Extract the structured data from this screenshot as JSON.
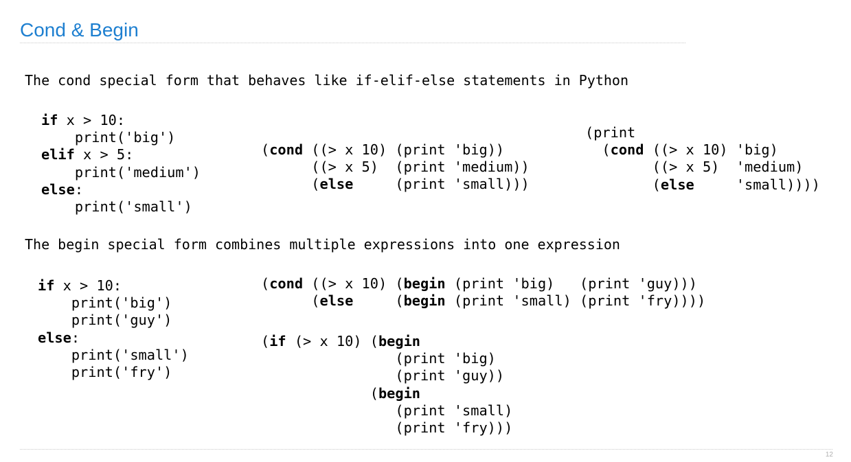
{
  "slide": {
    "title": "Cond & Begin",
    "page_number": "12"
  },
  "cond_section": {
    "description": "The cond special form that behaves like if-elif-else statements in Python",
    "python_lines": [
      [
        {
          "t": "if",
          "b": true
        },
        {
          "t": " x > 10:"
        }
      ],
      [
        {
          "t": "    print('big')"
        }
      ],
      [
        {
          "t": "elif",
          "b": true
        },
        {
          "t": " x > 5:"
        }
      ],
      [
        {
          "t": "    print('medium')"
        }
      ],
      [
        {
          "t": "else",
          "b": true
        },
        {
          "t": ":"
        }
      ],
      [
        {
          "t": "    print('small')"
        }
      ]
    ],
    "scheme_cond_lines": [
      [
        {
          "t": "("
        },
        {
          "t": "cond",
          "b": true
        },
        {
          "t": " ((> x 10) (print 'big))"
        }
      ],
      [
        {
          "t": "      ((> x 5)  (print 'medium))"
        }
      ],
      [
        {
          "t": "      ("
        },
        {
          "t": "else",
          "b": true
        },
        {
          "t": "     (print 'small)))"
        }
      ]
    ],
    "scheme_print_cond_lines": [
      [
        {
          "t": "(print"
        }
      ],
      [
        {
          "t": "  ("
        },
        {
          "t": "cond",
          "b": true
        },
        {
          "t": " ((> x 10) 'big)"
        }
      ],
      [
        {
          "t": "        ((> x 5)  'medium)"
        }
      ],
      [
        {
          "t": "        ("
        },
        {
          "t": "else",
          "b": true
        },
        {
          "t": "     'small))))"
        }
      ]
    ]
  },
  "begin_section": {
    "description": "The begin special form combines multiple expressions into one expression",
    "python_lines": [
      [
        {
          "t": "if",
          "b": true
        },
        {
          "t": " x > 10:"
        }
      ],
      [
        {
          "t": "    print('big')"
        }
      ],
      [
        {
          "t": "    print('guy')"
        }
      ],
      [
        {
          "t": "else",
          "b": true
        },
        {
          "t": ":"
        }
      ],
      [
        {
          "t": "    print('small')"
        }
      ],
      [
        {
          "t": "    print('fry')"
        }
      ]
    ],
    "scheme_cond_begin_lines": [
      [
        {
          "t": "("
        },
        {
          "t": "cond",
          "b": true
        },
        {
          "t": " ((> x 10) ("
        },
        {
          "t": "begin",
          "b": true
        },
        {
          "t": " (print 'big)   (print 'guy)))"
        }
      ],
      [
        {
          "t": "      ("
        },
        {
          "t": "else",
          "b": true
        },
        {
          "t": "     ("
        },
        {
          "t": "begin",
          "b": true
        },
        {
          "t": " (print 'small) (print 'fry))))"
        }
      ]
    ],
    "scheme_if_begin_lines": [
      [
        {
          "t": "("
        },
        {
          "t": "if",
          "b": true
        },
        {
          "t": " (> x 10) ("
        },
        {
          "t": "begin",
          "b": true
        }
      ],
      [
        {
          "t": "                (print 'big)"
        }
      ],
      [
        {
          "t": "                (print 'guy))"
        }
      ],
      [
        {
          "t": "             ("
        },
        {
          "t": "begin",
          "b": true
        }
      ],
      [
        {
          "t": "                (print 'small)"
        }
      ],
      [
        {
          "t": "                (print 'fry)))"
        }
      ]
    ]
  }
}
